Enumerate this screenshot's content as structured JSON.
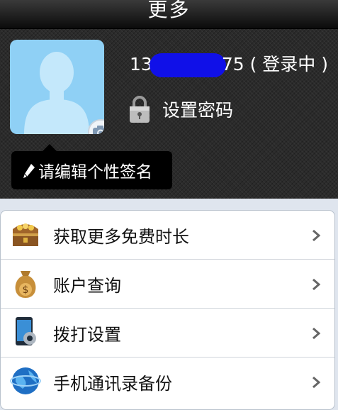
{
  "header": {
    "title": "更多"
  },
  "profile": {
    "phone_prefix": "13",
    "phone_suffix": "75",
    "status": "( 登录中 )",
    "set_password_label": "设置密码",
    "signature_placeholder": "请编辑个性签名",
    "avatar_icon": "default-user-silhouette",
    "camera_icon": "camera-icon",
    "lock_icon": "lock-icon",
    "pen_icon": "pencil-icon"
  },
  "menu": {
    "items": [
      {
        "label": "获取更多免费时长",
        "icon": "treasure-chest-icon"
      },
      {
        "label": "账户查询",
        "icon": "money-bag-icon"
      },
      {
        "label": "拨打设置",
        "icon": "phone-settings-icon"
      },
      {
        "label": "手机通讯录备份",
        "icon": "globe-icon"
      }
    ]
  },
  "colors": {
    "accent_blue": "#1010e8",
    "avatar_bg": "#8fd0f5"
  }
}
